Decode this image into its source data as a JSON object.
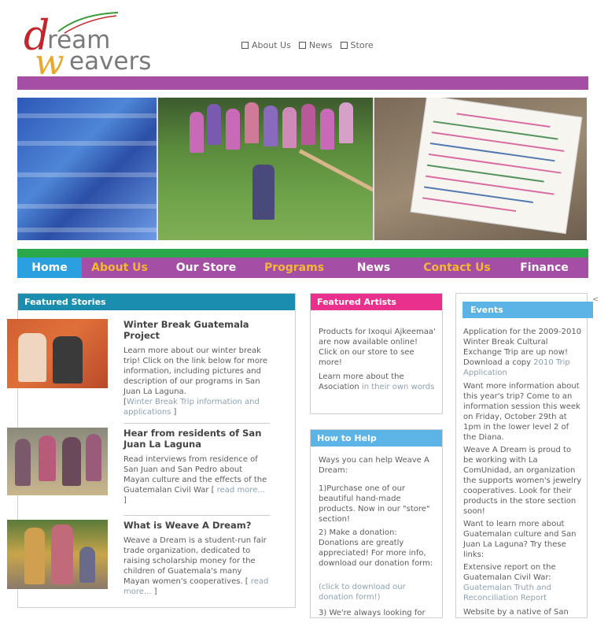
{
  "logo": {
    "d": "d",
    "ream": "ream",
    "w": "w",
    "eavers": "eavers"
  },
  "top_links": [
    "About Us",
    "News",
    "Store"
  ],
  "colors": {
    "purple": "#a44fa5",
    "green": "#2aa84a",
    "home_blue": "#2aa0e0",
    "gold": "#f5b730",
    "featured_teal": "#1b8eb0",
    "artists_pink": "#e8308c",
    "light_blue": "#5bb3e6"
  },
  "nav": {
    "home": "Home",
    "about": "About Us",
    "store": "Our Store",
    "programs": "Programs",
    "news": "News",
    "contact": "Contact Us",
    "finance": "Finance"
  },
  "featured": {
    "title": "Featured Stories",
    "stories": [
      {
        "title": "Winter Break Guatemala Project",
        "body": "Learn more about our winter break trip! Click on the link below for more information, including pictures and description of our programs in San Juan La Laguna.",
        "link_prefix": "[",
        "link": "Winter Break Trip information and applications",
        "link_suffix": " ]"
      },
      {
        "title": "Hear from residents of San Juan La Laguna",
        "body": "Read interviews from residence of San Juan and San Pedro about Mayan culture and the effects of the Guatemalan Civil War [",
        "link": " read more...",
        "link_suffix": " ]"
      },
      {
        "title": "What is Weave A Dream?",
        "body": "Weave a Dream is a student-run fair trade organization, dedicated to raising scholarship money for the children of Guatemala's many Mayan women's cooperatives. [",
        "link": " read more...",
        "link_suffix": " ]"
      }
    ]
  },
  "artists": {
    "title": "Featured Artists",
    "p1": "Products for Ixoqui Ajkeemaa' are now available online! Click on our store to see more!",
    "p2_prefix": "Learn more about the Asociation ",
    "p2_link": "in their own words"
  },
  "help": {
    "title": "How to Help",
    "p1": "Ways you can help Weave A Dream:",
    "p2": "1)Purchase one of our beautiful hand-made products. Now in our \"store\" section!",
    "p3": "2) Make a donation: Donations are greatly appreciated! For more info, download our donation form:",
    "p4": "(click to download our donation form!)",
    "p5": "3) We're always looking for"
  },
  "events": {
    "title": "Events",
    "p1_prefix": "Application for the 2009-2010 Winter Break Cultural Exchange Trip are up now! Download a copy ",
    "p1_link": "2010 Trip Application",
    "p2": "Want more information about this year's trip? Come to an information session this week on Friday, October 29th at 1pm in the lower level 2 of the Diana.",
    "p3": "Weave A Dream is proud to be working with La ComUnidad, an organization the supports women's jewelry cooperatives. Look for their products in the store section soon!",
    "p4": "Want to learn more about Guatemalan culture and San Juan La Laguna? Try these links:",
    "p5": "Extensive report on the Guatemalan Civil War: ",
    "p5_link": "Guatemalan Truth and Reconciliation Report",
    "p6": "Website by a native of San",
    "edge": "<"
  }
}
